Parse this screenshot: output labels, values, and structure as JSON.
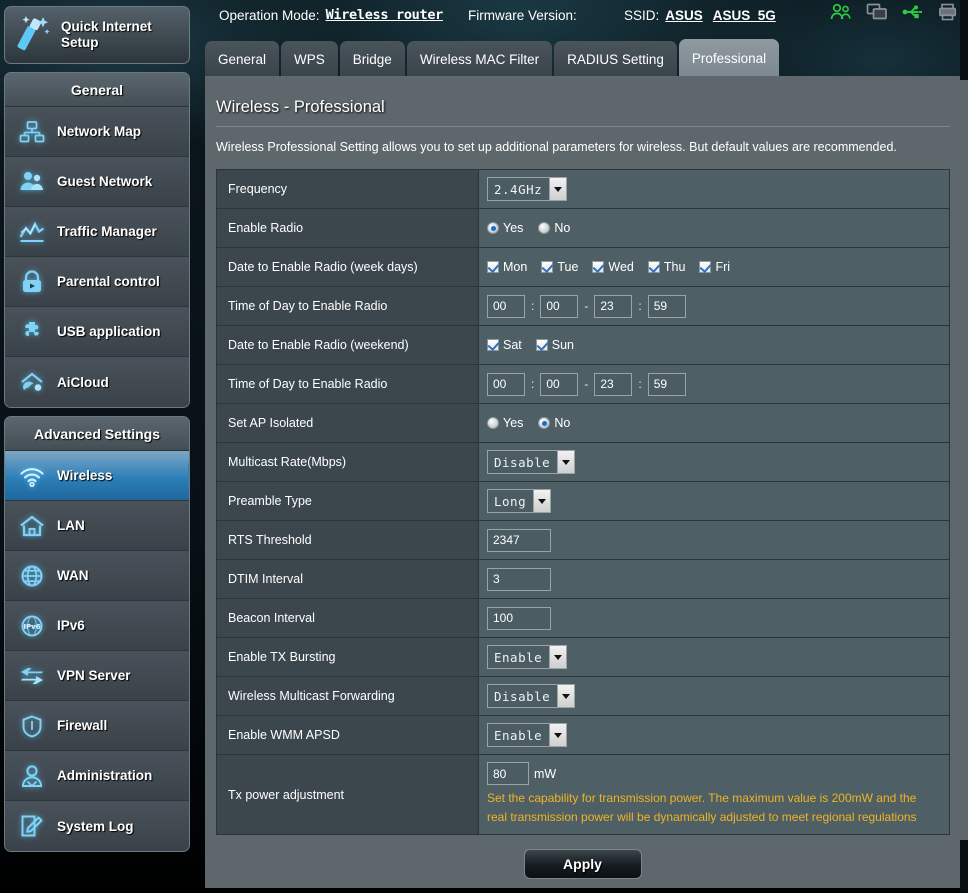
{
  "header": {
    "operation_mode_label": "Operation Mode:",
    "operation_mode_value": "Wireless router",
    "firmware_label": "Firmware Version:",
    "firmware_value": "",
    "ssid_label": "SSID:",
    "ssid_1": "ASUS",
    "ssid_2": "ASUS_5G",
    "icons": [
      {
        "name": "clients-icon",
        "color": "#2ecc40"
      },
      {
        "name": "network-devices-icon",
        "color": "#8a9298"
      },
      {
        "name": "usb-icon",
        "color": "#2ecc40"
      },
      {
        "name": "printer-icon",
        "color": "#8a9298"
      }
    ]
  },
  "sidebar": {
    "quick_setup": "Quick Internet Setup",
    "general_header": "General",
    "general_items": [
      {
        "label": "Network Map",
        "icon": "network-map-icon"
      },
      {
        "label": "Guest Network",
        "icon": "guest-network-icon"
      },
      {
        "label": "Traffic Manager",
        "icon": "traffic-manager-icon"
      },
      {
        "label": "Parental control",
        "icon": "parental-control-icon"
      },
      {
        "label": "USB application",
        "icon": "usb-application-icon"
      },
      {
        "label": "AiCloud",
        "icon": "aicloud-icon"
      }
    ],
    "advanced_header": "Advanced Settings",
    "advanced_items": [
      {
        "label": "Wireless",
        "icon": "wireless-icon",
        "active": true
      },
      {
        "label": "LAN",
        "icon": "lan-icon",
        "active": false
      },
      {
        "label": "WAN",
        "icon": "wan-icon",
        "active": false
      },
      {
        "label": "IPv6",
        "icon": "ipv6-icon",
        "active": false
      },
      {
        "label": "VPN Server",
        "icon": "vpn-server-icon",
        "active": false
      },
      {
        "label": "Firewall",
        "icon": "firewall-icon",
        "active": false
      },
      {
        "label": "Administration",
        "icon": "administration-icon",
        "active": false
      },
      {
        "label": "System Log",
        "icon": "system-log-icon",
        "active": false
      }
    ]
  },
  "tabs": [
    {
      "label": "General",
      "active": false
    },
    {
      "label": "WPS",
      "active": false
    },
    {
      "label": "Bridge",
      "active": false
    },
    {
      "label": "Wireless MAC Filter",
      "active": false
    },
    {
      "label": "RADIUS Setting",
      "active": false
    },
    {
      "label": "Professional",
      "active": true
    }
  ],
  "panel": {
    "title": "Wireless - Professional",
    "description": "Wireless Professional Setting allows you to set up additional parameters for wireless. But default values are recommended.",
    "apply_label": "Apply"
  },
  "form": {
    "frequency": {
      "label": "Frequency",
      "value": "2.4GHz"
    },
    "enable_radio": {
      "label": "Enable Radio",
      "yes_label": "Yes",
      "no_label": "No",
      "selected": "Yes"
    },
    "weekdays": {
      "label": "Date to Enable Radio (week days)",
      "days": [
        {
          "label": "Mon",
          "checked": true
        },
        {
          "label": "Tue",
          "checked": true
        },
        {
          "label": "Wed",
          "checked": true
        },
        {
          "label": "Thu",
          "checked": true
        },
        {
          "label": "Fri",
          "checked": true
        }
      ]
    },
    "weekday_time": {
      "label": "Time of Day to Enable Radio",
      "start_hour": "00",
      "start_min": "00",
      "end_hour": "23",
      "end_min": "59",
      "colon": ":",
      "dash": "-"
    },
    "weekend": {
      "label": "Date to Enable Radio (weekend)",
      "days": [
        {
          "label": "Sat",
          "checked": true
        },
        {
          "label": "Sun",
          "checked": true
        }
      ]
    },
    "weekend_time": {
      "label": "Time of Day to Enable Radio",
      "start_hour": "00",
      "start_min": "00",
      "end_hour": "23",
      "end_min": "59",
      "colon": ":",
      "dash": "-"
    },
    "ap_isolated": {
      "label": "Set AP Isolated",
      "yes_label": "Yes",
      "no_label": "No",
      "selected": "No"
    },
    "multicast_rate": {
      "label": "Multicast Rate(Mbps)",
      "value": "Disable"
    },
    "preamble_type": {
      "label": "Preamble Type",
      "value": "Long"
    },
    "rts_threshold": {
      "label": "RTS Threshold",
      "value": "2347"
    },
    "dtim_interval": {
      "label": "DTIM Interval",
      "value": "3"
    },
    "beacon_interval": {
      "label": "Beacon Interval",
      "value": "100"
    },
    "tx_bursting": {
      "label": "Enable TX Bursting",
      "value": "Enable"
    },
    "multicast_forwarding": {
      "label": "Wireless Multicast Forwarding",
      "value": "Disable"
    },
    "wmm_apsd": {
      "label": "Enable WMM APSD",
      "value": "Enable"
    },
    "tx_power": {
      "label": "Tx power adjustment",
      "value": "80",
      "unit": "mW",
      "hint": "Set the capability for transmission power. The maximum value is 200mW and the real transmission power will be dynamically adjusted to meet regional regulations"
    }
  }
}
